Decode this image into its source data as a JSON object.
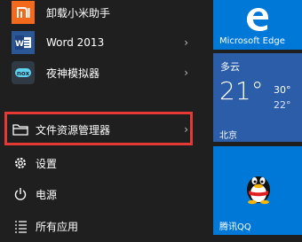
{
  "menu": {
    "apps": [
      {
        "label": "卸载小米助手",
        "icon": "xiaomi-icon",
        "color": "#f46a1d"
      },
      {
        "label": "Word 2013",
        "icon": "word-icon",
        "color": "#2b5797",
        "chevron": "›"
      },
      {
        "label": "夜神模拟器",
        "icon": "nox-icon",
        "color": "#2f3a44",
        "chevron": "›"
      }
    ],
    "file_explorer": {
      "label": "文件资源管理器",
      "chevron": "›"
    },
    "settings": {
      "label": "设置"
    },
    "power": {
      "label": "电源"
    },
    "all_apps": {
      "label": "所有应用"
    }
  },
  "tiles": {
    "edge": {
      "label": "Microsoft Edge",
      "color": "#0078d7"
    },
    "weather": {
      "condition": "多云",
      "temp": "21°",
      "high": "30°",
      "low": "22°",
      "city": "北京",
      "color": "#2b5da8"
    },
    "qq": {
      "label": "腾讯QQ",
      "color": "#0078d7"
    }
  },
  "highlight_color": "#e53935"
}
